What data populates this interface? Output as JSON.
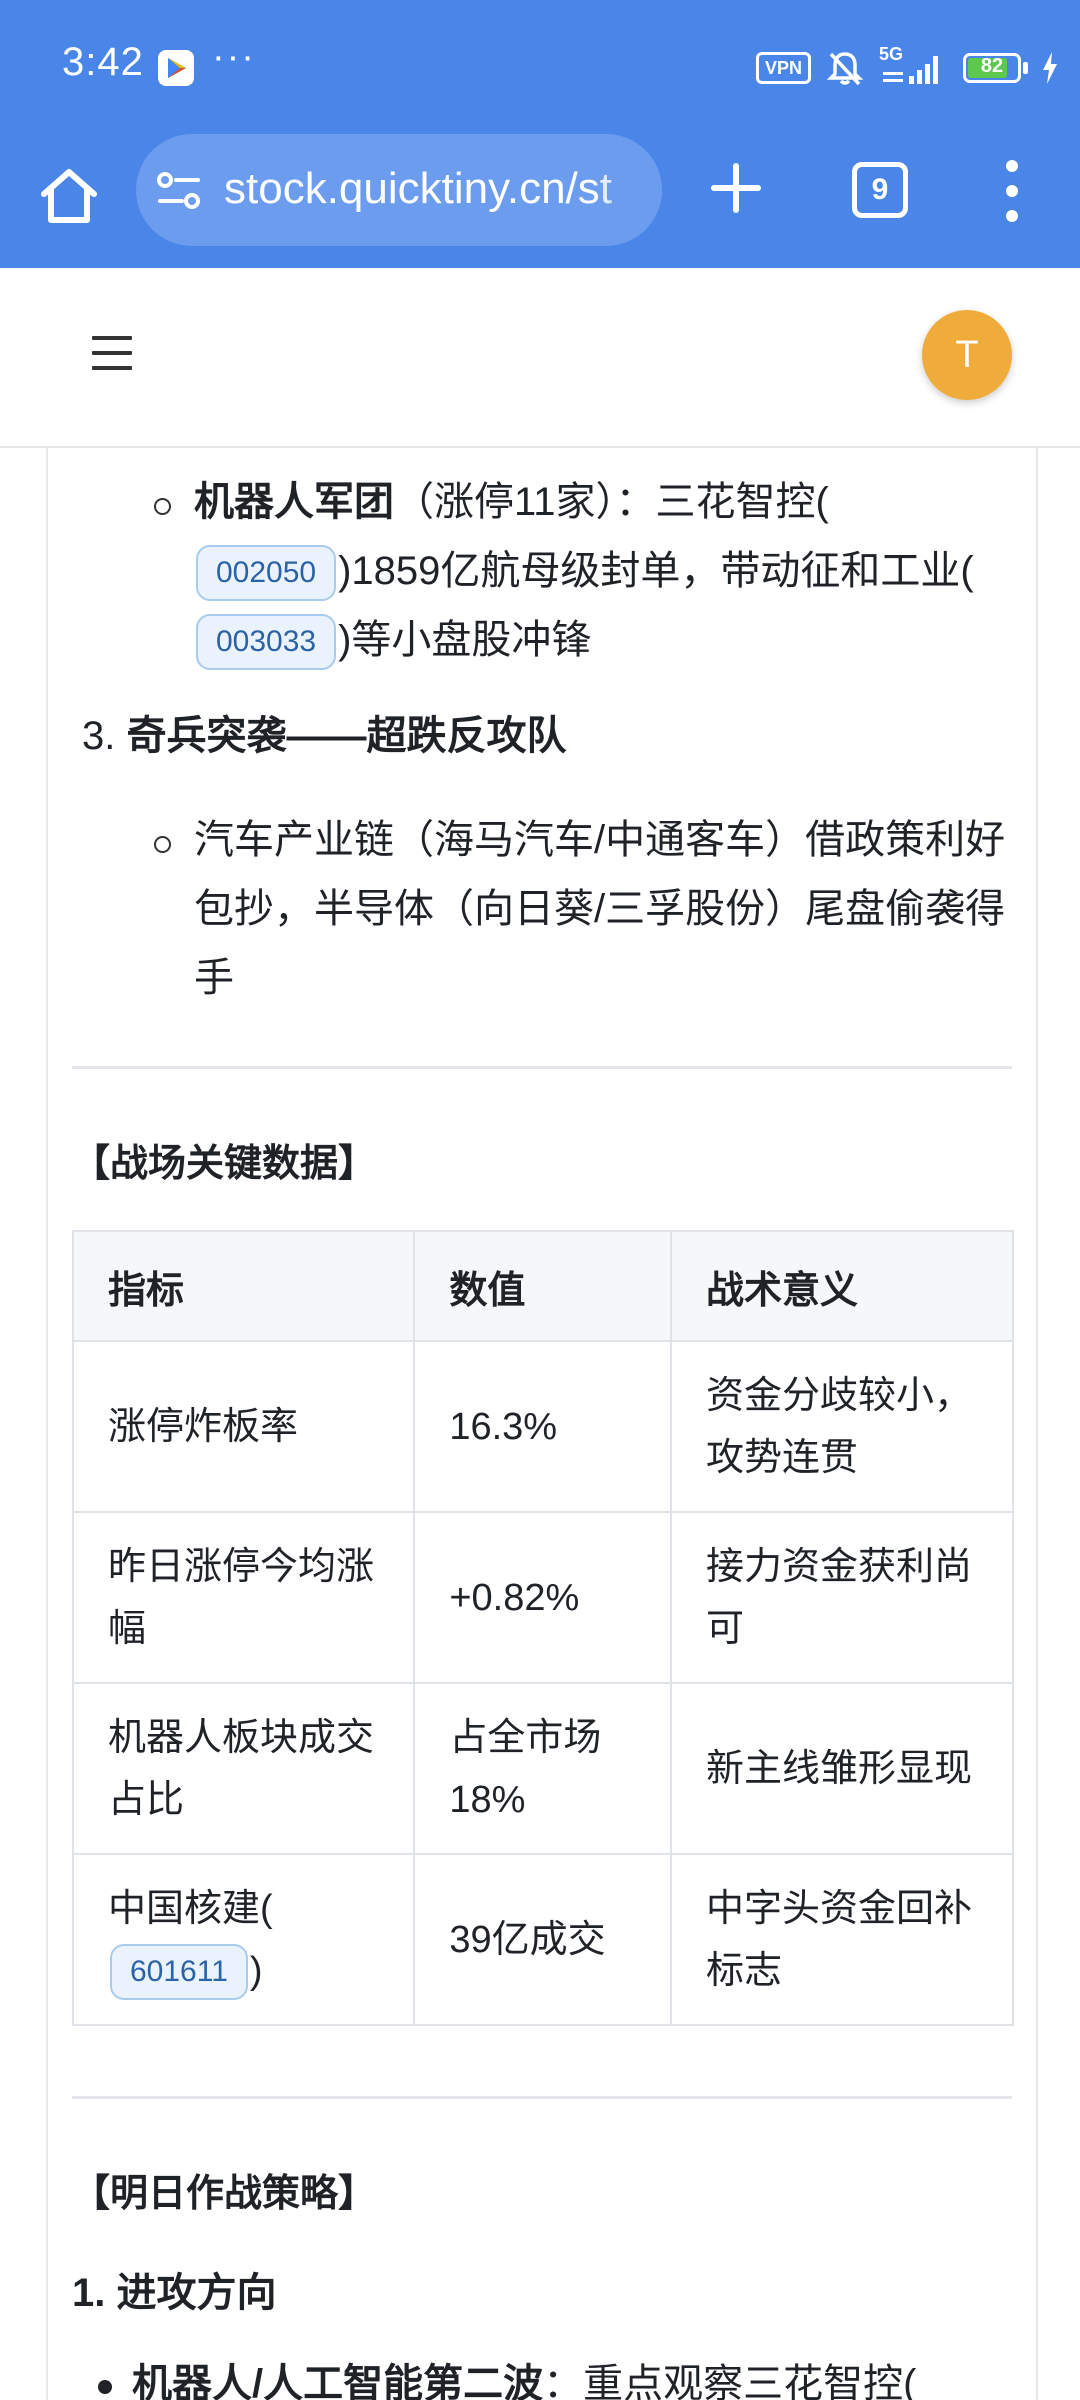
{
  "status_bar": {
    "time": "3:42",
    "more": "···",
    "vpn_label": "VPN",
    "network": "5G",
    "battery_level": "82",
    "battery_fill_fraction": 0.82
  },
  "browser": {
    "url": "stock.quicktiny.cn/st",
    "tab_count": "9",
    "icons": [
      "home-icon",
      "site-info-icon",
      "plus-icon",
      "tabs-icon",
      "more-vertical-icon"
    ]
  },
  "site_header": {
    "avatar_initial": "T"
  },
  "article": {
    "robot_item": {
      "title": "机器人军团",
      "text_1": "（涨停11家）：三花智控(",
      "code_1": "002050",
      "text_2": ")1859亿航母级封单，带动征和工业(",
      "code_2": "003033",
      "text_3": ")等小盘股冲锋"
    },
    "section3": {
      "number": "3.",
      "title": "奇兵突袭——超跌反攻队",
      "sub_text": "汽车产业链（海马汽车/中通客车）借政策利好包抄，半导体（向日葵/三孚股份）尾盘偷袭得手"
    },
    "key_data": {
      "title": "【战场关键数据】",
      "headers": [
        "指标",
        "数值",
        "战术意义"
      ],
      "rows": [
        {
          "c1": "涨停炸板率",
          "c2": "16.3%",
          "c3": "资金分歧较小，攻势连贯"
        },
        {
          "c1": "昨日涨停今均涨幅",
          "c2": "+0.82%",
          "c3": "接力资金获利尚可"
        },
        {
          "c1": "机器人板块成交占比",
          "c2": "占全市场18%",
          "c3": "新主线雏形显现"
        },
        {
          "c1_text": "中国核建(",
          "c1_code": "601611",
          "c1_end": ")",
          "c2": "39亿成交",
          "c3": "中字头资金回补标志"
        }
      ]
    },
    "strategy": {
      "title": "【明日作战策略】",
      "h3": "1. 进攻方向",
      "item_bold": "机器人/人工智能第二波",
      "item_text": "：重点观察三花智控("
    }
  },
  "colors": {
    "chrome_blue": "#4a86e8",
    "avatar": "#f0ac3a",
    "code_badge_bg": "#eaf3fd",
    "code_badge_text": "#2b63a6"
  }
}
